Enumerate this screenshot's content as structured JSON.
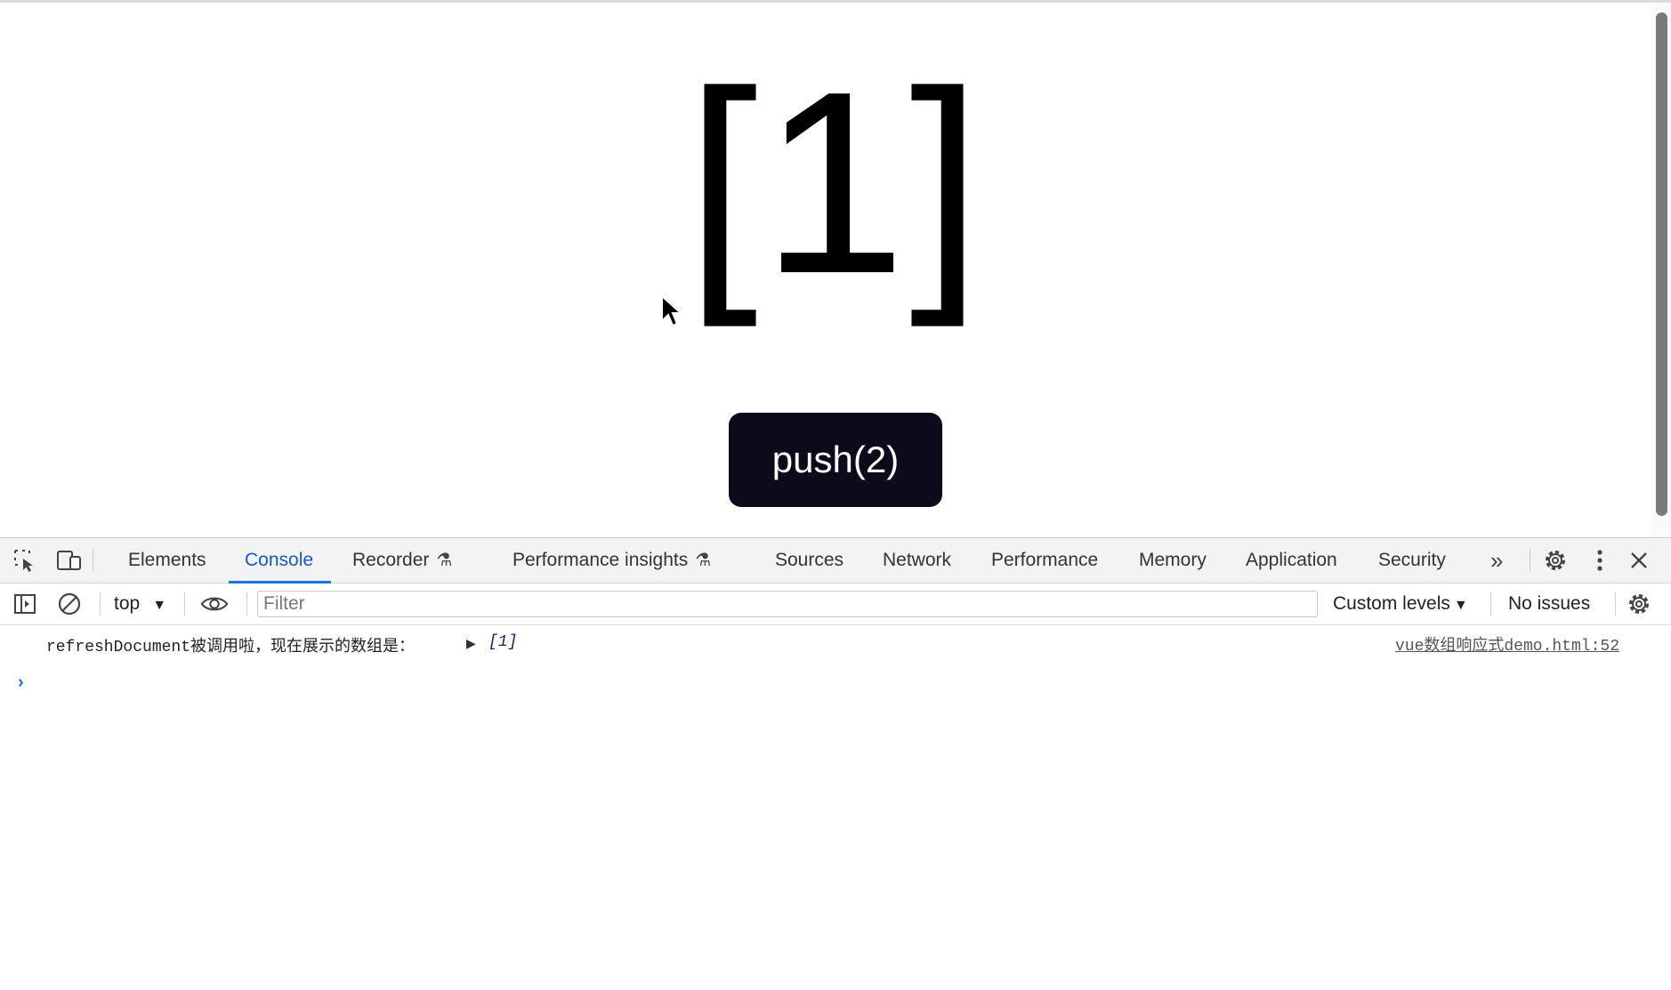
{
  "page": {
    "array_display": "[1]",
    "push_button_label": "push(2)"
  },
  "devtools": {
    "tabs": [
      {
        "label": "Elements"
      },
      {
        "label": "Console",
        "active": true
      },
      {
        "label": "Recorder",
        "flask": "⚗"
      },
      {
        "label": "Performance insights",
        "flask": "⚗"
      },
      {
        "label": "Sources"
      },
      {
        "label": "Network"
      },
      {
        "label": "Performance"
      },
      {
        "label": "Memory"
      },
      {
        "label": "Application"
      },
      {
        "label": "Security"
      }
    ],
    "more_tabs_glyph": "»",
    "toolbar": {
      "context": "top",
      "filter_placeholder": "Filter",
      "levels": "Custom levels",
      "issues": "No issues"
    },
    "console": {
      "message": "refreshDocument被调用啦，现在展示的数组是：",
      "array_value": "[1]",
      "source": "vue数组响应式demo.html:52",
      "prompt": "›"
    },
    "icons": [
      "inspect-element-icon",
      "device-toolbar-icon",
      "settings-gear-icon",
      "kebab-menu-icon",
      "close-icon",
      "sidebar-toggle-icon",
      "clear-console-icon",
      "eye-icon",
      "more-tabs-icon"
    ],
    "accent_color": "#1a73e8",
    "button_color": "#0b0b1b"
  }
}
